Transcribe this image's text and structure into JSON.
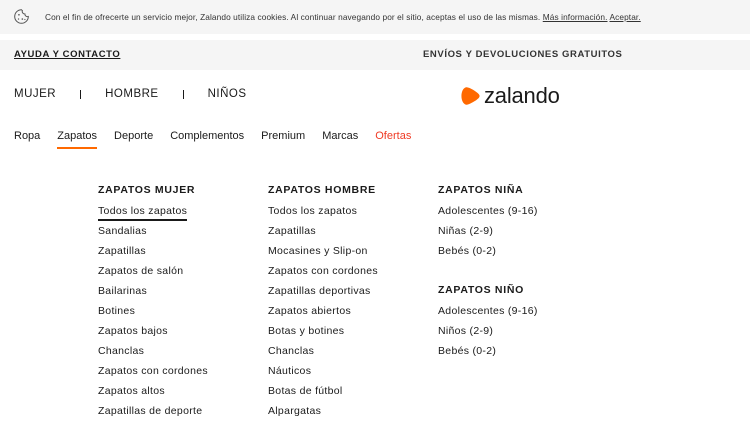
{
  "cookie": {
    "text": "Con el fin de ofrecerte un servicio mejor, Zalando utiliza cookies. Al continuar navegando por el sitio, aceptas el uso de las mismas.",
    "more_info": "Más información.",
    "accept": "Aceptar."
  },
  "service": {
    "help": "AYUDA Y CONTACTO",
    "shipping": "ENVÍOS Y DEVOLUCIONES GRATUITOS"
  },
  "gender_nav": [
    "MUJER",
    "HOMBRE",
    "NIÑOS"
  ],
  "logo": {
    "text": "zalando",
    "color": "#ff6900"
  },
  "categories": [
    "Ropa",
    "Zapatos",
    "Deporte",
    "Complementos",
    "Premium",
    "Marcas",
    "Ofertas"
  ],
  "menu": {
    "women": {
      "title": "ZAPATOS MUJER",
      "items": [
        "Todos los zapatos",
        "Sandalias",
        "Zapatillas",
        "Zapatos de salón",
        "Bailarinas",
        "Botines",
        "Zapatos bajos",
        "Chanclas",
        "Zapatos con cordones",
        "Zapatos altos",
        "Zapatillas de deporte"
      ]
    },
    "men": {
      "title": "ZAPATOS HOMBRE",
      "items": [
        "Todos los zapatos",
        "Zapatillas",
        "Mocasines y Slip-on",
        "Zapatos con cordones",
        "Zapatillas deportivas",
        "Zapatos abiertos",
        "Botas y botines",
        "Chanclas",
        "Náuticos",
        "Botas de fútbol",
        "Alpargatas"
      ]
    },
    "girls": {
      "title": "ZAPATOS NIÑA",
      "items": [
        "Adolescentes (9-16)",
        "Niñas (2-9)",
        "Bebés (0-2)"
      ]
    },
    "boys": {
      "title": "ZAPATOS NIÑO",
      "items": [
        "Adolescentes (9-16)",
        "Niños (2-9)",
        "Bebés (0-2)"
      ]
    }
  }
}
